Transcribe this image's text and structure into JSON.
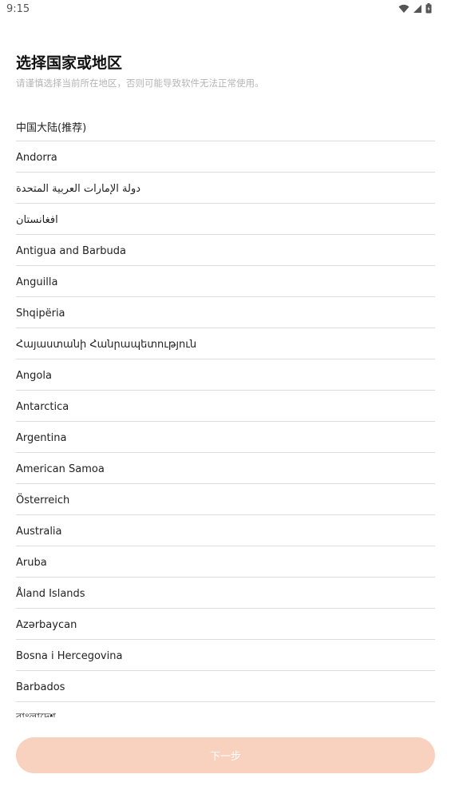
{
  "status_bar": {
    "time": "9:15",
    "icons": [
      "wifi-icon",
      "cell-signal-icon",
      "battery-icon"
    ]
  },
  "header": {
    "title": "选择国家或地区",
    "subtitle": "请谨慎选择当前所在地区，否则可能导致软件无法正常使用。"
  },
  "regions": [
    "中国大陆(推荐)",
    "Andorra",
    "دولة الإمارات العربية المتحدة",
    "افغانستان",
    "Antigua and Barbuda",
    "Anguilla",
    "Shqipëria",
    "Հայաստանի Հանրապետություն",
    "Angola",
    "Antarctica",
    "Argentina",
    "American Samoa",
    "Österreich",
    "Australia",
    "Aruba",
    "Åland Islands",
    "Azərbaycan",
    "Bosna i Hercegovina",
    "Barbados",
    "বাংলাদেশ"
  ],
  "footer": {
    "next_label": "下一步"
  },
  "colors": {
    "button_disabled": "#f8d2bf",
    "divider": "#dcdcdc",
    "subtitle": "#b5b5b5"
  }
}
